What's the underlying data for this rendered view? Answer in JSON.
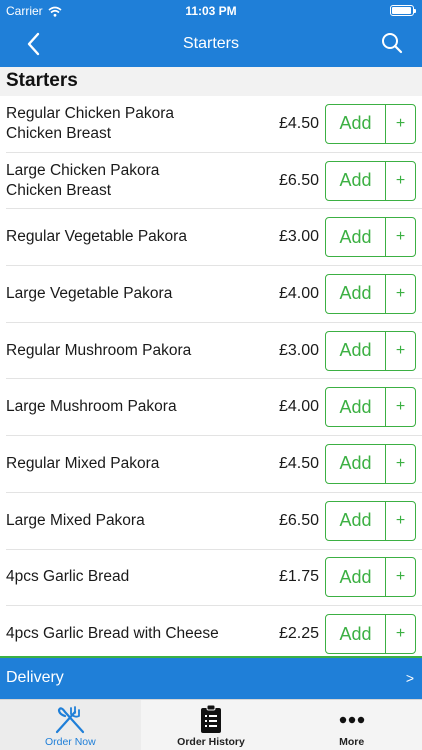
{
  "status": {
    "carrier": "Carrier",
    "time": "11:03 PM"
  },
  "nav": {
    "title": "Starters"
  },
  "section": {
    "title": "Starters"
  },
  "items": [
    {
      "name": "Regular Chicken Pakora\nChicken Breast",
      "price": "£4.50",
      "add": "Add",
      "plus": "+"
    },
    {
      "name": "Large Chicken Pakora\nChicken Breast",
      "price": "£6.50",
      "add": "Add",
      "plus": "+"
    },
    {
      "name": "Regular Vegetable Pakora",
      "price": "£3.00",
      "add": "Add",
      "plus": "+"
    },
    {
      "name": "Large Vegetable Pakora",
      "price": "£4.00",
      "add": "Add",
      "plus": "+"
    },
    {
      "name": "Regular Mushroom Pakora",
      "price": "£3.00",
      "add": "Add",
      "plus": "+"
    },
    {
      "name": "Large Mushroom Pakora",
      "price": "£4.00",
      "add": "Add",
      "plus": "+"
    },
    {
      "name": "Regular Mixed Pakora",
      "price": "£4.50",
      "add": "Add",
      "plus": "+"
    },
    {
      "name": "Large Mixed Pakora",
      "price": "£6.50",
      "add": "Add",
      "plus": "+"
    },
    {
      "name": "4pcs Garlic Bread",
      "price": "£1.75",
      "add": "Add",
      "plus": "+"
    },
    {
      "name": "4pcs Garlic Bread with Cheese",
      "price": "£2.25",
      "add": "Add",
      "plus": "+"
    }
  ],
  "delivery": {
    "label": "Delivery",
    "chevron": ">"
  },
  "tabs": [
    {
      "label": "Order Now",
      "icon": "fork-knife-icon"
    },
    {
      "label": "Order History",
      "icon": "clipboard-icon"
    },
    {
      "label": "More",
      "icon": "more-dots-icon"
    }
  ],
  "colors": {
    "primary": "#1f7fd8",
    "accent": "#3cb043"
  }
}
